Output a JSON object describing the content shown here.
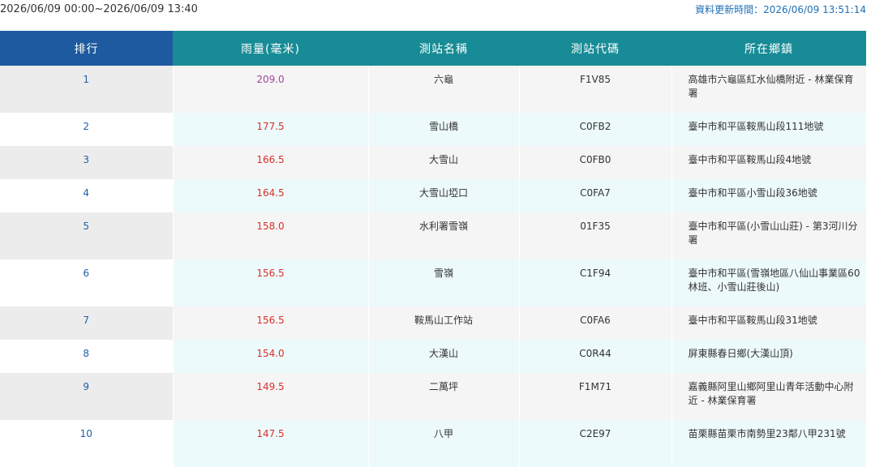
{
  "header": {
    "time_range": "2026/06/09 00:00~2026/06/09 13:40",
    "update_time": "資料更新時間：2026/06/09 13:51:14"
  },
  "table": {
    "columns": [
      "排行",
      "雨量(毫米)",
      "測站名稱",
      "測站代碼",
      "所在鄉鎮"
    ],
    "rows": [
      {
        "rank": "1",
        "rain": "209.0",
        "station": "六龜",
        "code": "F1V85",
        "town": "高雄市六龜區紅水仙橋附近 - 林業保育署"
      },
      {
        "rank": "2",
        "rain": "177.5",
        "station": "雪山橋",
        "code": "C0FB2",
        "town": "臺中市和平區鞍馬山段111地號"
      },
      {
        "rank": "3",
        "rain": "166.5",
        "station": "大雪山",
        "code": "C0FB0",
        "town": "臺中市和平區鞍馬山段4地號"
      },
      {
        "rank": "4",
        "rain": "164.5",
        "station": "大雪山埡口",
        "code": "C0FA7",
        "town": "臺中市和平區小雪山段36地號"
      },
      {
        "rank": "5",
        "rain": "158.0",
        "station": "水利署雪嶺",
        "code": "01F35",
        "town": "臺中市和平區(小雪山山莊) - 第3河川分署"
      },
      {
        "rank": "6",
        "rain": "156.5",
        "station": "雪嶺",
        "code": "C1F94",
        "town": "臺中市和平區(雪嶺地區八仙山事業區60林班、小雪山莊後山)"
      },
      {
        "rank": "7",
        "rain": "156.5",
        "station": "鞍馬山工作站",
        "code": "C0FA6",
        "town": "臺中市和平區鞍馬山段31地號"
      },
      {
        "rank": "8",
        "rain": "154.0",
        "station": "大漢山",
        "code": "C0R44",
        "town": "屏東縣春日鄉(大漢山頂)"
      },
      {
        "rank": "9",
        "rain": "149.5",
        "station": "二萬坪",
        "code": "F1M71",
        "town": "嘉義縣阿里山鄉阿里山青年活動中心附近 - 林業保育署"
      },
      {
        "rank": "10",
        "rain": "147.5",
        "station": "八甲",
        "code": "C2E97",
        "town": "苗栗縣苗栗市南勢里23鄰八甲231號"
      }
    ]
  },
  "colors": {
    "rank_header": "#1e5aa0",
    "header": "#188c96",
    "rain_value": "#d9302b",
    "rain_value_top": "#a0479e",
    "update_text": "#1f6fb5"
  }
}
